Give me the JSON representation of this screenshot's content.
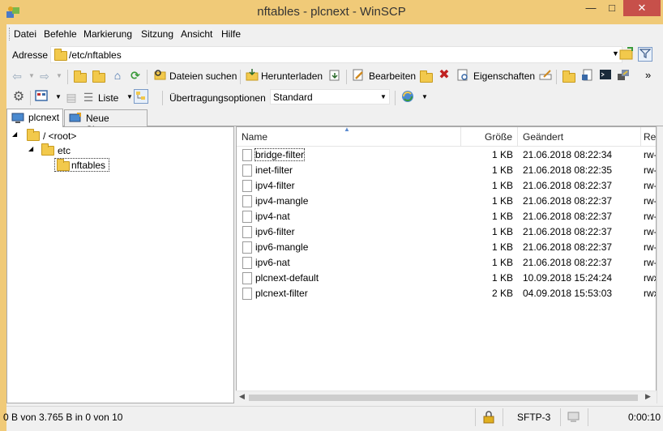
{
  "window": {
    "title": "nftables - plcnext - WinSCP",
    "minimize_symbol": "—",
    "maximize_symbol": "□",
    "close_symbol": "✕"
  },
  "menu": [
    "Datei",
    "Befehle",
    "Markierung",
    "Sitzung",
    "Ansicht",
    "Hilfe"
  ],
  "address": {
    "label": "Adresse",
    "path": "/etc/nftables"
  },
  "toolbar": {
    "find_files": "Dateien suchen",
    "download": "Herunterladen",
    "edit": "Bearbeiten",
    "properties": "Eigenschaften",
    "view_label": "Liste",
    "transfer_options_label": "Übertragungsoptionen",
    "transfer_preset": "Standard",
    "more": "»"
  },
  "tabs": [
    {
      "label": "plcnext",
      "active": true
    },
    {
      "label": "Neue Sitzung",
      "active": false
    }
  ],
  "tree": [
    {
      "label": "/ <root>",
      "expander": "◢"
    },
    {
      "label": "etc",
      "expander": "◢"
    },
    {
      "label": "nftables",
      "expander": ""
    }
  ],
  "columns": {
    "name": "Name",
    "size": "Größe",
    "changed": "Geändert",
    "rights": "Re"
  },
  "files": [
    {
      "name": "bridge-filter",
      "size": "1 KB",
      "changed": "21.06.2018 08:22:34",
      "rights": "rw-"
    },
    {
      "name": "inet-filter",
      "size": "1 KB",
      "changed": "21.06.2018 08:22:35",
      "rights": "rw-"
    },
    {
      "name": "ipv4-filter",
      "size": "1 KB",
      "changed": "21.06.2018 08:22:37",
      "rights": "rw-"
    },
    {
      "name": "ipv4-mangle",
      "size": "1 KB",
      "changed": "21.06.2018 08:22:37",
      "rights": "rw-"
    },
    {
      "name": "ipv4-nat",
      "size": "1 KB",
      "changed": "21.06.2018 08:22:37",
      "rights": "rw-"
    },
    {
      "name": "ipv6-filter",
      "size": "1 KB",
      "changed": "21.06.2018 08:22:37",
      "rights": "rw-"
    },
    {
      "name": "ipv6-mangle",
      "size": "1 KB",
      "changed": "21.06.2018 08:22:37",
      "rights": "rw-"
    },
    {
      "name": "ipv6-nat",
      "size": "1 KB",
      "changed": "21.06.2018 08:22:37",
      "rights": "rw-"
    },
    {
      "name": "plcnext-default",
      "size": "1 KB",
      "changed": "10.09.2018 15:24:24",
      "rights": "rwx"
    },
    {
      "name": "plcnext-filter",
      "size": "2 KB",
      "changed": "04.09.2018 15:53:03",
      "rights": "rwx"
    }
  ],
  "status": {
    "selection": "0 B von 3.765 B in 0 von 10",
    "protocol": "SFTP-3",
    "time": "0:00:10"
  },
  "colors": {
    "titlebar": "#f0ca78",
    "close": "#c7504a",
    "folder": "#f2c94c"
  }
}
